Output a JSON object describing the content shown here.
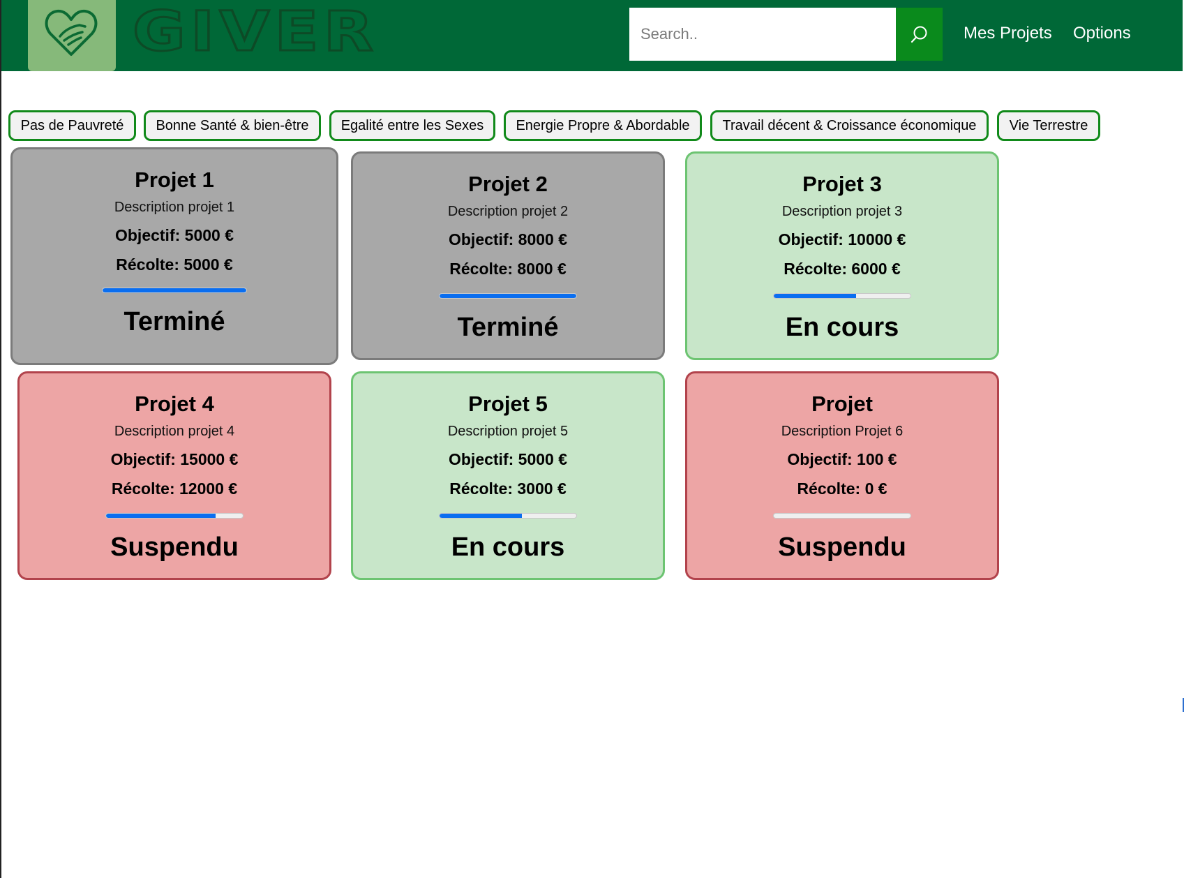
{
  "header": {
    "brand_name": "GIVER",
    "search_placeholder": "Search..",
    "search_value": "",
    "nav": [
      "Mes Projets",
      "Options"
    ],
    "icons": {
      "logo": "heart-hand-icon",
      "search": "search-icon"
    },
    "colors": {
      "header_bg": "#006837",
      "logo_tile": "#86b97a",
      "search_button": "#0a8a1c"
    }
  },
  "categories": [
    "Pas de Pauvreté",
    "Bonne Santé & bien-être",
    "Egalité entre les Sexes",
    "Energie Propre & Abordable",
    "Travail décent & Croissance économique",
    "Vie Terrestre"
  ],
  "projects": [
    {
      "title": "Projet 1",
      "description": "Description projet 1",
      "goal": "Objectif: 5000 €",
      "raised": "Récolte: 5000 €",
      "progress": 1.0,
      "status": "Terminé",
      "state": "grey"
    },
    {
      "title": "Projet 2",
      "description": "Description projet 2",
      "goal": "Objectif: 8000 €",
      "raised": "Récolte: 8000 €",
      "progress": 1.0,
      "status": "Terminé",
      "state": "grey"
    },
    {
      "title": "Projet 3",
      "description": "Description projet 3",
      "goal": "Objectif: 10000 €",
      "raised": "Récolte: 6000 €",
      "progress": 0.6,
      "status": "En cours",
      "state": "green"
    },
    {
      "title": "Projet 4",
      "description": "Description projet 4",
      "goal": "Objectif: 15000 €",
      "raised": "Récolte: 12000 €",
      "progress": 0.8,
      "status": "Suspendu",
      "state": "red"
    },
    {
      "title": "Projet 5",
      "description": "Description projet 5",
      "goal": "Objectif: 5000 €",
      "raised": "Récolte: 3000 €",
      "progress": 0.6,
      "status": "En cours",
      "state": "green"
    },
    {
      "title": "Projet",
      "description": "Description Projet 6",
      "goal": "Objectif: 100 €",
      "raised": "Récolte: 0 €",
      "progress": 0.0,
      "status": "Suspendu",
      "state": "red"
    }
  ],
  "colors": {
    "grey_card": "#a8a8a8",
    "green_card": "#c8e6c9",
    "red_card": "#eda5a5",
    "progress_fill": "#0a6ef0",
    "category_border": "#118a1a"
  }
}
